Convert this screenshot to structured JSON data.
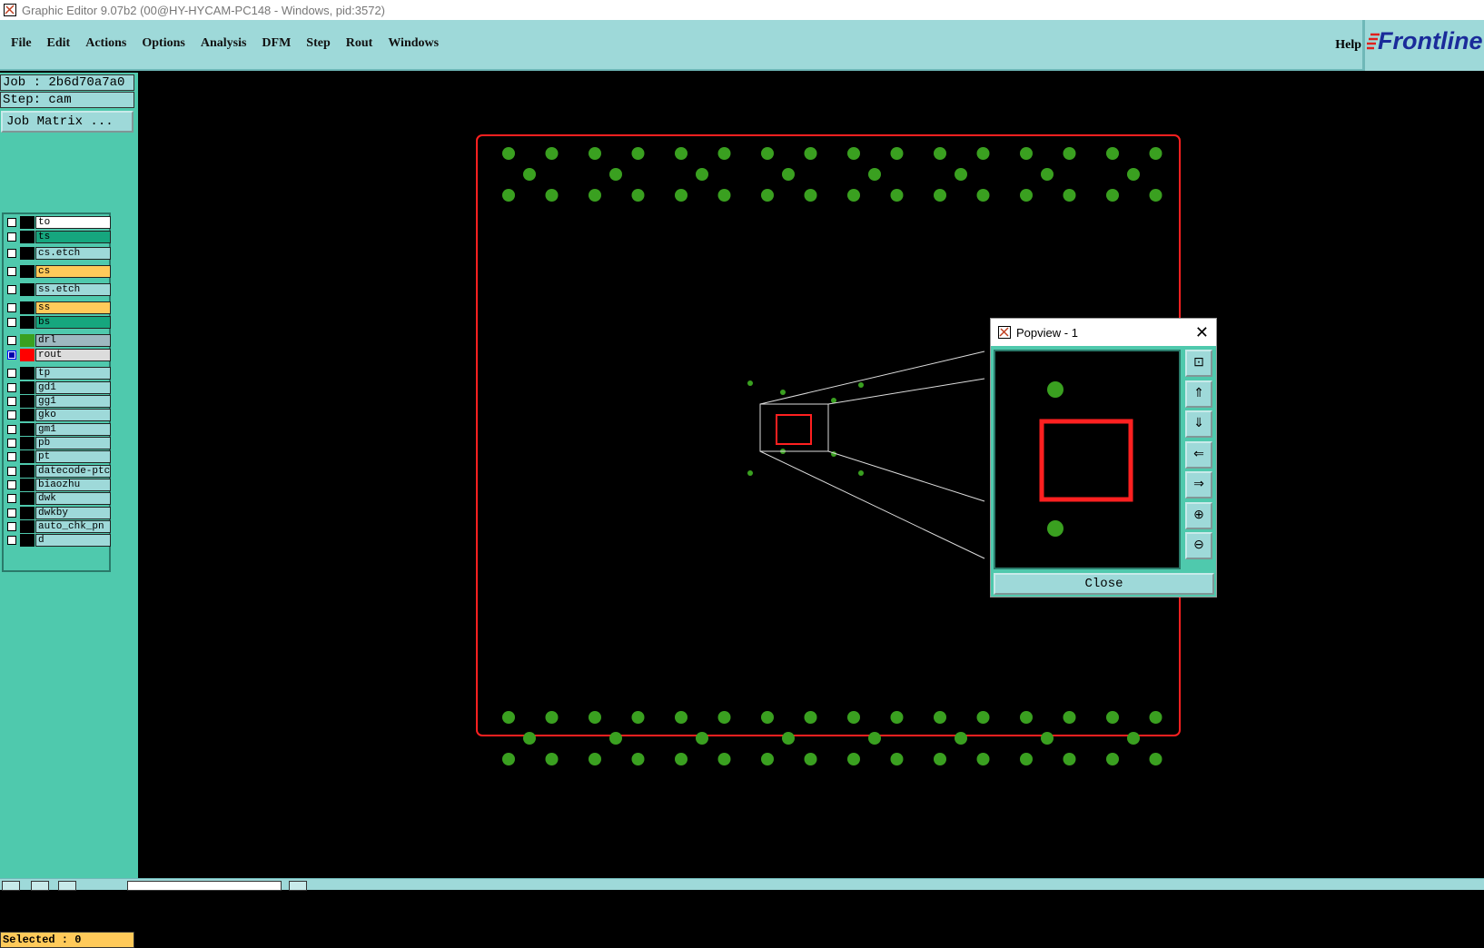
{
  "window": {
    "title": "Graphic Editor 9.07b2 (00@HY-HYCAM-PC148 - Windows, pid:3572)"
  },
  "menu": {
    "items": [
      "File",
      "Edit",
      "Actions",
      "Options",
      "Analysis",
      "DFM",
      "Step",
      "Rout",
      "Windows"
    ],
    "help": "Help"
  },
  "logo": {
    "text": "Frontline"
  },
  "sidebar": {
    "job": "Job : 2b6d70a7a0",
    "step": "Step: cam",
    "job_matrix": "Job Matrix ...",
    "selected": "Selected : 0",
    "layers": [
      {
        "name": "to",
        "color": "#ffffff",
        "swatch": "#000000",
        "checked": false
      },
      {
        "name": "ts",
        "color": "#16a67e",
        "swatch": "#000000",
        "checked": false
      },
      {
        "name": "cs.etch",
        "color": "#9ed9d9",
        "swatch": "#000000",
        "checked": false
      },
      {
        "name": "cs",
        "color": "#ffca5a",
        "swatch": "#000000",
        "checked": false
      },
      {
        "name": "ss.etch",
        "color": "#9ed9d9",
        "swatch": "#000000",
        "checked": false
      },
      {
        "name": "ss",
        "color": "#ffca5a",
        "swatch": "#000000",
        "checked": false
      },
      {
        "name": "bs",
        "color": "#16a67e",
        "swatch": "#000000",
        "checked": false
      },
      {
        "name": "drl",
        "color": "#9eb8c0",
        "swatch": "#3aa020",
        "checked": false
      },
      {
        "name": "rout",
        "color": "#dcdcdc",
        "swatch": "#ff0000",
        "checked": true
      },
      {
        "name": "tp",
        "color": "#9ed9d9",
        "swatch": "#000000",
        "checked": false
      },
      {
        "name": "gd1",
        "color": "#9ed9d9",
        "swatch": "#000000",
        "checked": false
      },
      {
        "name": "gg1",
        "color": "#9ed9d9",
        "swatch": "#000000",
        "checked": false
      },
      {
        "name": "gko",
        "color": "#9ed9d9",
        "swatch": "#000000",
        "checked": false
      },
      {
        "name": "gm1",
        "color": "#9ed9d9",
        "swatch": "#000000",
        "checked": false
      },
      {
        "name": "pb",
        "color": "#9ed9d9",
        "swatch": "#000000",
        "checked": false
      },
      {
        "name": "pt",
        "color": "#9ed9d9",
        "swatch": "#000000",
        "checked": false
      },
      {
        "name": "datecode-ptc",
        "color": "#9ed9d9",
        "swatch": "#000000",
        "checked": false
      },
      {
        "name": "biaozhu",
        "color": "#9ed9d9",
        "swatch": "#000000",
        "checked": false
      },
      {
        "name": "dwk",
        "color": "#9ed9d9",
        "swatch": "#000000",
        "checked": false
      },
      {
        "name": "dwkby",
        "color": "#9ed9d9",
        "swatch": "#000000",
        "checked": false
      },
      {
        "name": "auto_chk_pn",
        "color": "#9ed9d9",
        "swatch": "#000000",
        "checked": false
      },
      {
        "name": "d",
        "color": "#9ed9d9",
        "swatch": "#000000",
        "checked": false
      }
    ]
  },
  "popview": {
    "title": "Popview - 1",
    "close": "Close",
    "tools": [
      "zoom-fit-icon",
      "pan-up-icon",
      "pan-down-icon",
      "pan-left-icon",
      "pan-right-icon",
      "zoom-in-icon",
      "zoom-out-icon"
    ]
  },
  "colors": {
    "pad": "#3aa020",
    "rout": "#ff2020",
    "menu_bg": "#9ed9d9",
    "sidebar_bg": "#4fc9ad"
  }
}
